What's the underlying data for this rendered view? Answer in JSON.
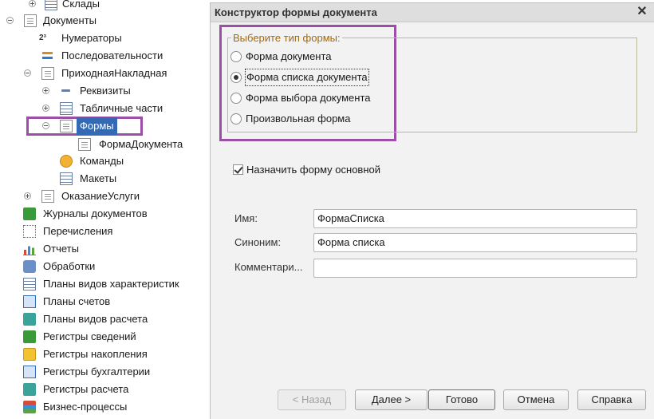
{
  "tree": {
    "items": [
      {
        "label": "Склады",
        "icon": "table-icon"
      },
      {
        "label": "Документы",
        "icon": "document-icon"
      },
      {
        "label": "Нумераторы",
        "icon": "numerator-icon"
      },
      {
        "label": "Последовательности",
        "icon": "sequence-icon"
      },
      {
        "label": "ПриходнаяНакладная",
        "icon": "document-icon"
      },
      {
        "label": "Реквизиты",
        "icon": "attributes-icon"
      },
      {
        "label": "Табличные части",
        "icon": "table-icon"
      },
      {
        "label": "Формы",
        "icon": "form-icon"
      },
      {
        "label": "ФормаДокумента",
        "icon": "form-icon"
      },
      {
        "label": "Команды",
        "icon": "command-icon"
      },
      {
        "label": "Макеты",
        "icon": "template-icon"
      },
      {
        "label": "ОказаниеУслуги",
        "icon": "document-icon"
      },
      {
        "label": "Журналы документов",
        "icon": "journal-icon"
      },
      {
        "label": "Перечисления",
        "icon": "enum-icon"
      },
      {
        "label": "Отчеты",
        "icon": "report-icon"
      },
      {
        "label": "Обработки",
        "icon": "processing-icon"
      },
      {
        "label": "Планы видов характеристик",
        "icon": "chart-types-icon"
      },
      {
        "label": "Планы счетов",
        "icon": "accounts-icon"
      },
      {
        "label": "Планы видов расчета",
        "icon": "calc-types-icon"
      },
      {
        "label": "Регистры сведений",
        "icon": "info-register-icon"
      },
      {
        "label": "Регистры накопления",
        "icon": "accum-register-icon"
      },
      {
        "label": "Регистры бухгалтерии",
        "icon": "acc-register-icon"
      },
      {
        "label": "Регистры расчета",
        "icon": "calc-register-icon"
      },
      {
        "label": "Бизнес-процессы",
        "icon": "business-process-icon"
      }
    ]
  },
  "dialog": {
    "title": "Конструктор формы документа",
    "close": "✕",
    "group_label": "Выберите тип формы:",
    "radios": [
      {
        "label": "Форма документа",
        "selected": false
      },
      {
        "label": "Форма списка документа",
        "selected": true
      },
      {
        "label": "Форма выбора документа",
        "selected": false
      },
      {
        "label": "Произвольная форма",
        "selected": false
      }
    ],
    "checkbox": {
      "label": "Назначить форму основной",
      "checked": true
    },
    "fields": {
      "name_label": "Имя:",
      "name_value": "ФормаСписка",
      "synonym_label": "Синоним:",
      "synonym_value": "Форма списка",
      "comment_label": "Комментари...",
      "comment_value": ""
    },
    "buttons": {
      "back": "< Назад",
      "next": "Далее >",
      "done": "Готово",
      "cancel": "Отмена",
      "help": "Справка"
    }
  },
  "colors": {
    "highlight": "#9b4fa6",
    "selection": "#3469b4"
  }
}
